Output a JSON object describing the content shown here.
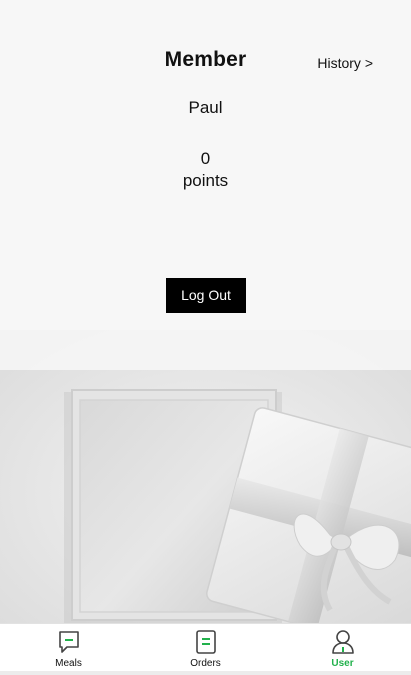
{
  "header": {
    "title": "Member",
    "history_link": "History >"
  },
  "member": {
    "name": "Paul",
    "points_value": "0",
    "points_label": "points"
  },
  "actions": {
    "logout_label": "Log Out"
  },
  "tabbar": {
    "tabs": [
      {
        "label": "Meals",
        "icon": "chat-bubble-icon",
        "active": false
      },
      {
        "label": "Orders",
        "icon": "document-list-icon",
        "active": false
      },
      {
        "label": "User",
        "icon": "user-icon",
        "active": true
      }
    ]
  },
  "colors": {
    "accent": "#22b14c",
    "button_bg": "#000000",
    "background": "#f7f7f7"
  }
}
